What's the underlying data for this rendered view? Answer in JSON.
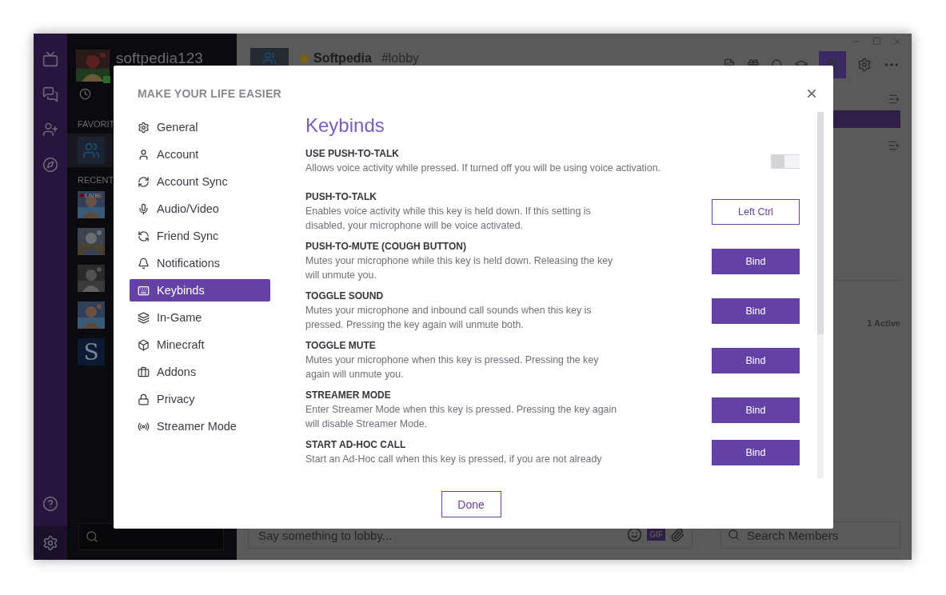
{
  "sidebar": {
    "username": "softpedia123",
    "favorites_label": "FAVORIT",
    "recents_label": "RECENT",
    "recents": [
      {
        "kind": "live",
        "badge": "LIVE"
      },
      {
        "kind": "picture"
      },
      {
        "kind": "picture"
      },
      {
        "kind": "picture"
      },
      {
        "kind": "letter",
        "letter": "S"
      }
    ]
  },
  "channel": {
    "server": "Softpedia",
    "name": "#lobby",
    "starred": true
  },
  "members": {
    "active": "1 Active",
    "search_placeholder": "Search Members"
  },
  "chat": {
    "placeholder": "Say something to lobby...",
    "gif": "GIF"
  },
  "dialog": {
    "title": "MAKE YOUR LIFE EASIER",
    "close": "×",
    "heading": "Keybinds",
    "nav": [
      {
        "label": "General",
        "selected": false
      },
      {
        "label": "Account",
        "selected": false
      },
      {
        "label": "Account Sync",
        "selected": false
      },
      {
        "label": "Audio/Video",
        "selected": false
      },
      {
        "label": "Friend Sync",
        "selected": false
      },
      {
        "label": "Notifications",
        "selected": false
      },
      {
        "label": "Keybinds",
        "selected": true
      },
      {
        "label": "In-Game",
        "selected": false
      },
      {
        "label": "Minecraft",
        "selected": false
      },
      {
        "label": "Addons",
        "selected": false
      },
      {
        "label": "Privacy",
        "selected": false
      },
      {
        "label": "Streamer Mode",
        "selected": false
      }
    ],
    "settings": [
      {
        "kind": "toggle",
        "title": "USE PUSH-TO-TALK",
        "description": "Allows voice activity while pressed. If turned off you will be using voice activation.",
        "on": false
      },
      {
        "kind": "key",
        "title": "PUSH-TO-TALK",
        "description": "Enables voice activity while this key is held down. If this setting is disabled, your microphone will be voice activated.",
        "button": "Left Ctrl",
        "bound": true
      },
      {
        "kind": "key",
        "title": "PUSH-TO-MUTE (COUGH BUTTON)",
        "description": "Mutes your microphone while this key is held down. Releasing the key will unmute you.",
        "button": "Bind",
        "bound": false
      },
      {
        "kind": "key",
        "title": "TOGGLE SOUND",
        "description": "Mutes your microphone and inbound call sounds when this key is pressed. Pressing the key again will unmute both.",
        "button": "Bind",
        "bound": false
      },
      {
        "kind": "key",
        "title": "TOGGLE MUTE",
        "description": "Mutes your microphone when this key is pressed. Pressing the key again will unmute you.",
        "button": "Bind",
        "bound": false
      },
      {
        "kind": "key",
        "title": "STREAMER MODE",
        "description": "Enter Streamer Mode when this key is pressed. Pressing the key again will disable Streamer Mode.",
        "button": "Bind",
        "bound": false
      },
      {
        "kind": "key",
        "title": "START AD-HOC CALL",
        "description": "Start an Ad-Hoc call when this key is pressed, if you are not already",
        "button": "Bind",
        "bound": false
      }
    ],
    "done": "Done"
  }
}
